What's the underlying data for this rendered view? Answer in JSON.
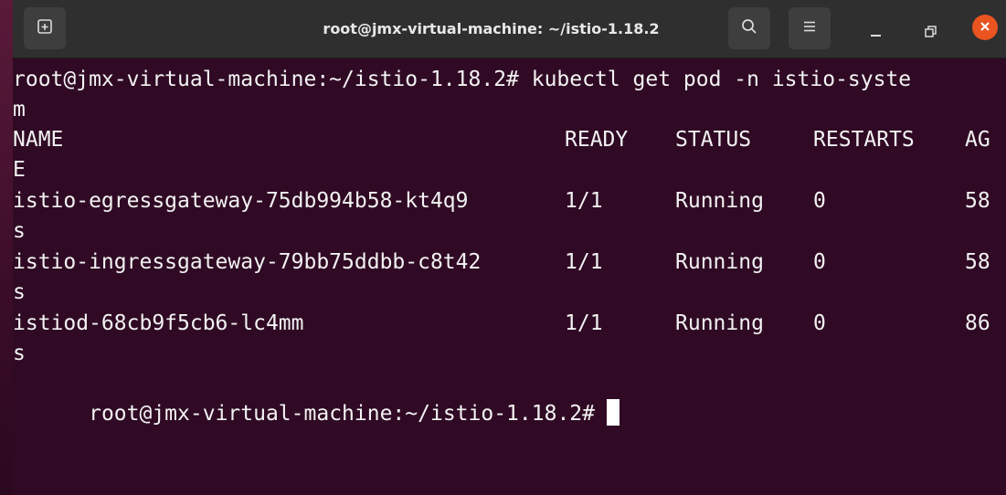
{
  "window": {
    "title": "root@jmx-virtual-machine: ~/istio-1.18.2",
    "buttons": {
      "new_tab_icon": "new-tab-icon",
      "search_icon": "search-icon",
      "menu_icon": "hamburger-menu-icon",
      "minimize_icon": "minimize-icon",
      "restore_icon": "restore-icon",
      "close_icon": "close-icon"
    },
    "colors": {
      "terminal_bg": "#300a24",
      "titlebar_bg": "#2f2f2f",
      "close_accent": "#e95420",
      "text": "#f2f2f2"
    }
  },
  "terminal": {
    "command_line": "root@jmx-virtual-machine:~/istio-1.18.2# kubectl get pod -n istio-syste",
    "command_wrap": "m",
    "headers": {
      "name": "NAME",
      "ready": "READY",
      "status": "STATUS",
      "restarts": "RESTARTS",
      "age": "AG",
      "age_wrap": "E"
    },
    "rows": [
      {
        "name": "istio-egressgateway-75db994b58-kt4q9",
        "ready": "1/1",
        "status": "Running",
        "restarts": "0",
        "age": "58",
        "age_wrap": "s"
      },
      {
        "name": "istio-ingressgateway-79bb75ddbb-c8t42",
        "ready": "1/1",
        "status": "Running",
        "restarts": "0",
        "age": "58",
        "age_wrap": "s"
      },
      {
        "name": "istiod-68cb9f5cb6-lc4mm",
        "ready": "1/1",
        "status": "Running",
        "restarts": "0",
        "age": "86",
        "age_wrap": "s"
      }
    ],
    "prompt": "root@jmx-virtual-machine:~/istio-1.18.2#"
  }
}
